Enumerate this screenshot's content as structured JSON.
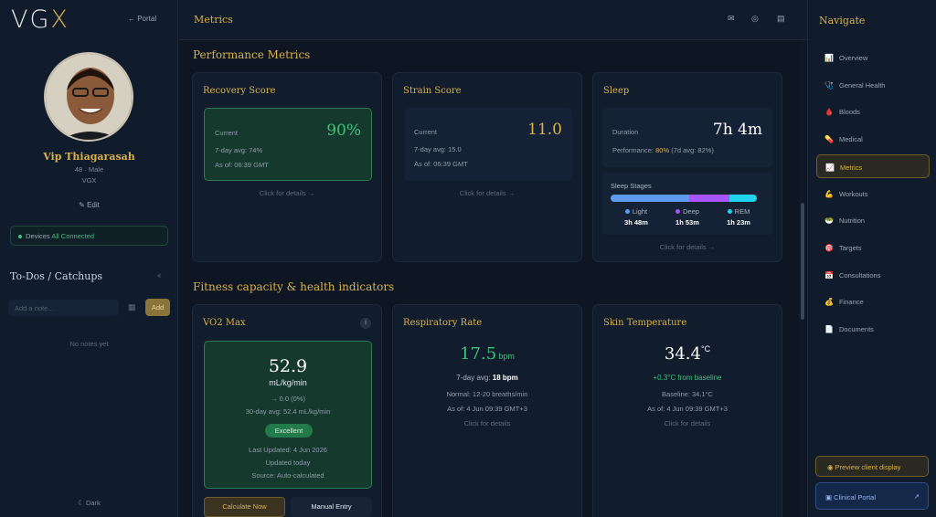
{
  "app": {
    "logo_main": "VG",
    "logo_accent": "X",
    "portal_link": "← Portal"
  },
  "profile": {
    "name": "Vip Thiagarasah",
    "meta": "48 · Male",
    "org": "VGX",
    "edit": "Edit",
    "devices_label": "Devices",
    "devices_status": "All Connected"
  },
  "todo": {
    "title": "To-Dos / Catchups",
    "placeholder": "Add a note...",
    "add": "Add",
    "empty": "No notes yet",
    "dark": "Dark"
  },
  "header": {
    "title": "Metrics",
    "icons": [
      "mail-icon",
      "whatsapp-icon",
      "document-icon"
    ]
  },
  "performance": {
    "title": "Performance Metrics",
    "recovery": {
      "title": "Recovery Score",
      "current_label": "Current",
      "value": "90%",
      "avg": "7-day avg: 74%",
      "asof": "As of: 06:39 GMT",
      "details": "Click for details →"
    },
    "strain": {
      "title": "Strain Score",
      "current_label": "Current",
      "value": "11.0",
      "avg": "7-day avg: 15.0",
      "asof": "As of: 06:39 GMT",
      "details": "Click for details →"
    },
    "sleep": {
      "title": "Sleep",
      "duration_label": "Duration",
      "duration": "7h 4m",
      "perf_label": "Performance: ",
      "perf_value": "80%",
      "perf_avg": " (7d avg: 82%)",
      "stages_label": "Sleep Stages",
      "stages": [
        {
          "name": "Light",
          "value": "3h 48m",
          "color": "#5b9bf0",
          "fraction": 0.54
        },
        {
          "name": "Deep",
          "value": "1h 53m",
          "color": "#a855f7",
          "fraction": 0.27
        },
        {
          "name": "REM",
          "value": "1h 23m",
          "color": "#22d3ee",
          "fraction": 0.19
        }
      ],
      "details": "Click for details →"
    }
  },
  "fitness": {
    "title": "Fitness capacity & health indicators",
    "vo2": {
      "title": "VO2 Max",
      "info": "i",
      "value": "52.9",
      "unit": "mL/kg/min",
      "change": "→ 0.0 (0%)",
      "avg": "30-day avg: 52.4 mL/kg/min",
      "badge": "Excellent",
      "updated": "Last Updated: 4 Jun 2026",
      "updated_rel": "Updated today",
      "source": "Source: Auto-calculated",
      "calc_btn": "Calculate Now",
      "manual_btn": "Manual Entry"
    },
    "resp": {
      "title": "Respiratory Rate",
      "value": "17.5",
      "unit": "bpm",
      "avg_label": "7-day avg: ",
      "avg_value": "18 bpm",
      "normal": "Normal: 12-20 breaths/min",
      "asof": "As of: 4 Jun 09:39 GMT+3",
      "details": "Click for details"
    },
    "skin": {
      "title": "Skin Temperature",
      "value": "34.4",
      "unit": "°C",
      "delta": "+0.3°C from baseline",
      "baseline": "Baseline: 34.1°C",
      "asof": "As of: 4 Jun 09:39 GMT+3",
      "details": "Click for details"
    }
  },
  "nav": {
    "title": "Navigate",
    "items": [
      {
        "label": "Overview",
        "icon": "📊"
      },
      {
        "label": "General Health",
        "icon": "🩺"
      },
      {
        "label": "Bloods",
        "icon": "🩸"
      },
      {
        "label": "Medical",
        "icon": "💊"
      },
      {
        "label": "Metrics",
        "icon": "📈"
      },
      {
        "label": "Workouts",
        "icon": "💪"
      },
      {
        "label": "Nutrition",
        "icon": "🥗"
      },
      {
        "label": "Targets",
        "icon": "🎯"
      },
      {
        "label": "Consultations",
        "icon": "📅"
      },
      {
        "label": "Finance",
        "icon": "💰"
      },
      {
        "label": "Documents",
        "icon": "📄"
      }
    ],
    "preview": "Preview client display",
    "clinical": "Clinical Portal"
  },
  "colors": {
    "accent": "#d8b24a",
    "green": "#3fc27b",
    "bg": "#0e1624"
  }
}
